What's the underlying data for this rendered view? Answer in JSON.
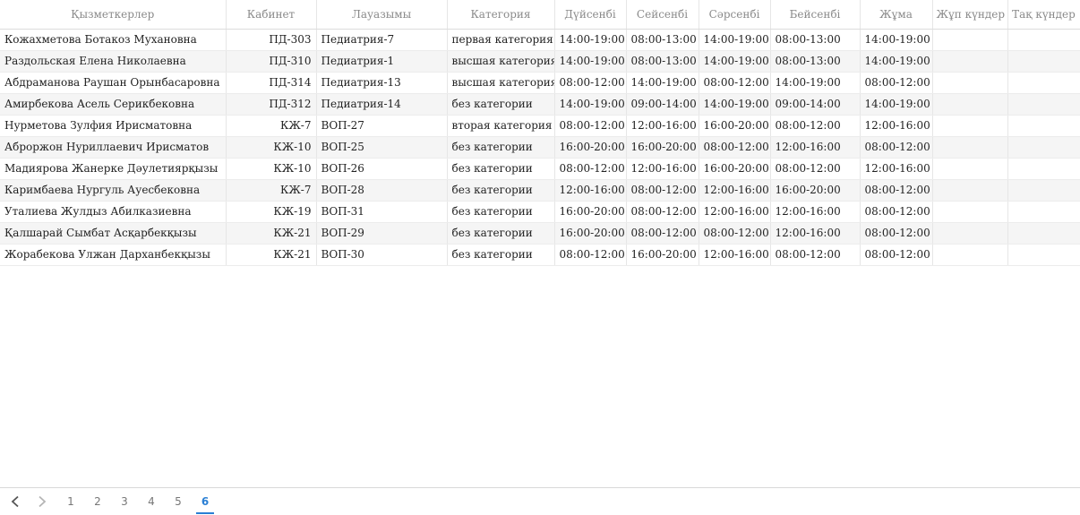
{
  "table": {
    "columns": [
      "Қызметкерлер",
      "Кабинет",
      "Лауазымы",
      "Категория",
      "Дүйсенбі",
      "Сейсенбі",
      "Сәрсенбі",
      "Бейсенбі",
      "Жұма",
      "Жұп күндер",
      "Тақ күндер"
    ],
    "rows": [
      [
        "Кожахметова Ботакоз Мухановна",
        "ПД-303",
        "Педиатрия-7",
        "первая категория",
        "14:00-19:00",
        "08:00-13:00",
        "14:00-19:00",
        "08:00-13:00",
        "14:00-19:00",
        "",
        ""
      ],
      [
        "Раздольская Елена Николаевна",
        "ПД-310",
        "Педиатрия-1",
        "высшая категория",
        "14:00-19:00",
        "08:00-13:00",
        "14:00-19:00",
        "08:00-13:00",
        "14:00-19:00",
        "",
        ""
      ],
      [
        "Абдраманова Раушан Орынбасаровна",
        "ПД-314",
        "Педиатрия-13",
        "высшая категория",
        "08:00-12:00",
        "14:00-19:00",
        "08:00-12:00",
        "14:00-19:00",
        "08:00-12:00",
        "",
        ""
      ],
      [
        "Амирбекова Асель Серикбековна",
        "ПД-312",
        "Педиатрия-14",
        "без категории",
        "14:00-19:00",
        "09:00-14:00",
        "14:00-19:00",
        "09:00-14:00",
        "14:00-19:00",
        "",
        ""
      ],
      [
        "Нурметова Зулфия Ирисматовна",
        "КЖ-7",
        "ВОП-27",
        "вторая категория",
        "08:00-12:00",
        "12:00-16:00",
        "16:00-20:00",
        "08:00-12:00",
        "12:00-16:00",
        "",
        ""
      ],
      [
        "Аброржон Нуриллаевич Ирисматов",
        "КЖ-10",
        "ВОП-25",
        "без категории",
        "16:00-20:00",
        "16:00-20:00",
        "08:00-12:00",
        "12:00-16:00",
        "08:00-12:00",
        "",
        ""
      ],
      [
        "Мадиярова Жанерке Дәулетиярқызы",
        "КЖ-10",
        "ВОП-26",
        "без категории",
        "08:00-12:00",
        "12:00-16:00",
        "16:00-20:00",
        "08:00-12:00",
        "12:00-16:00",
        "",
        ""
      ],
      [
        "Каримбаева Нургуль Ауесбековна",
        "КЖ-7",
        "ВОП-28",
        "без категории",
        "12:00-16:00",
        "08:00-12:00",
        "12:00-16:00",
        "16:00-20:00",
        "08:00-12:00",
        "",
        ""
      ],
      [
        "Уталиева Жулдыз Абилказиевна",
        "КЖ-19",
        "ВОП-31",
        "без категории",
        "16:00-20:00",
        "08:00-12:00",
        "12:00-16:00",
        "12:00-16:00",
        "08:00-12:00",
        "",
        ""
      ],
      [
        "Қалшарай Сымбат Асқарбекқызы",
        "КЖ-21",
        "ВОП-29",
        "без категории",
        "16:00-20:00",
        "08:00-12:00",
        "08:00-12:00",
        "12:00-16:00",
        "08:00-12:00",
        "",
        ""
      ],
      [
        "Жорабекова Улжан Дарханбекқызы",
        "КЖ-21",
        "ВОП-30",
        "без категории",
        "08:00-12:00",
        "16:00-20:00",
        "12:00-16:00",
        "08:00-12:00",
        "08:00-12:00",
        "",
        ""
      ]
    ]
  },
  "pager": {
    "prev_icon": "chevron-left-icon",
    "next_icon": "chevron-right-icon",
    "pages": [
      "1",
      "2",
      "3",
      "4",
      "5",
      "6"
    ],
    "current_page": "6",
    "accent_color": "#2a7fd4"
  }
}
